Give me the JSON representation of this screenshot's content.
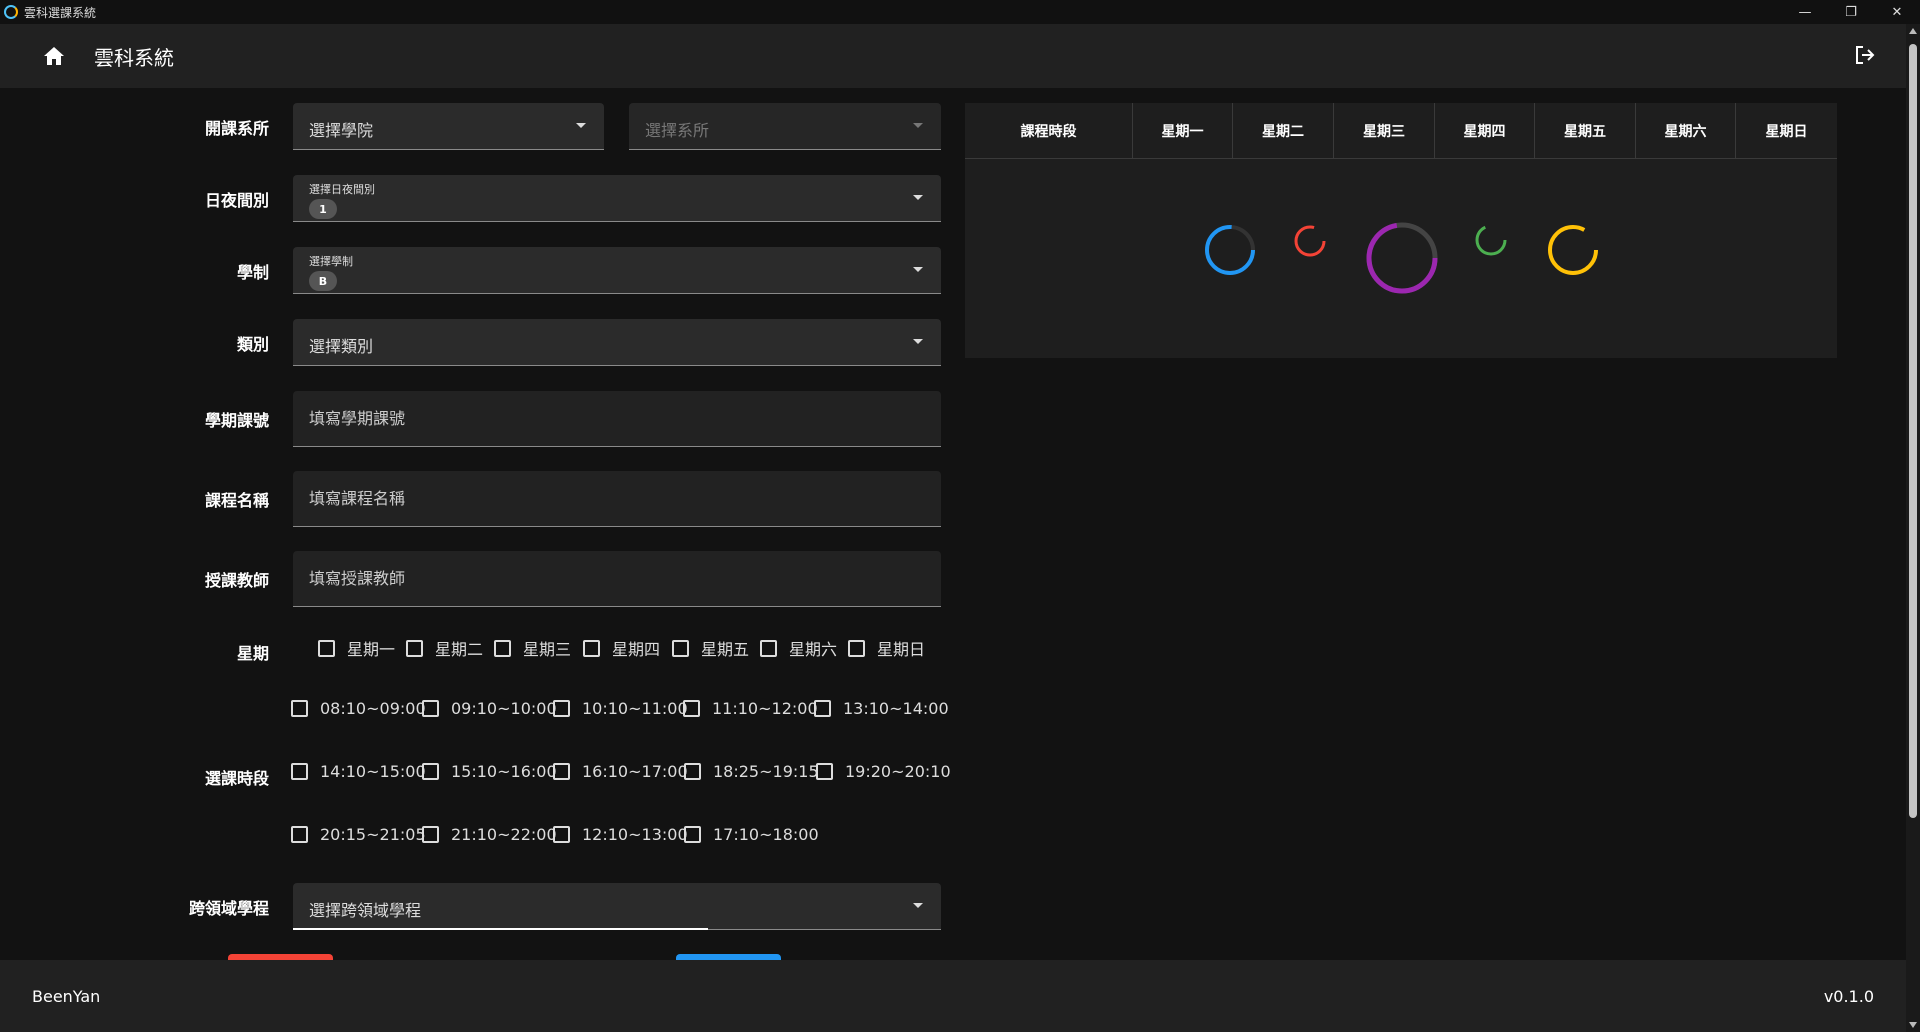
{
  "window": {
    "title": "雲科選課系統",
    "controls": [
      "minimize-icon",
      "restore-icon",
      "close-icon"
    ]
  },
  "appbar": {
    "title": "雲科系統",
    "home_icon": "home-icon",
    "logout_icon": "logout-icon"
  },
  "form": {
    "dept": {
      "label": "開課系所",
      "college_placeholder": "選擇學院",
      "dept_placeholder": "選擇系所"
    },
    "daynight": {
      "label": "日夜間別",
      "field_label": "選擇日夜間別",
      "chip": "1"
    },
    "system": {
      "label": "學制",
      "field_label": "選擇學制",
      "chip": "B"
    },
    "category": {
      "label": "類別",
      "placeholder": "選擇類別"
    },
    "course_no": {
      "label": "學期課號",
      "placeholder": "填寫學期課號"
    },
    "course_name": {
      "label": "課程名稱",
      "placeholder": "填寫課程名稱"
    },
    "teacher": {
      "label": "授課教師",
      "placeholder": "填寫授課教師"
    },
    "weekday": {
      "label": "星期",
      "options": [
        "星期一",
        "星期二",
        "星期三",
        "星期四",
        "星期五",
        "星期六",
        "星期日"
      ]
    },
    "timeslot": {
      "label": "選課時段",
      "rows": [
        [
          "08:10~09:00",
          "09:10~10:00",
          "10:10~11:00",
          "11:10~12:00",
          "13:10~14:00"
        ],
        [
          "14:10~15:00",
          "15:10~16:00",
          "16:10~17:00",
          "18:25~19:15",
          "19:20~20:10"
        ],
        [
          "20:15~21:05",
          "21:10~22:00",
          "12:10~13:00",
          "17:10~18:00"
        ]
      ]
    },
    "cross": {
      "label": "跨領域學程",
      "placeholder": "選擇跨領域學程"
    }
  },
  "schedule": {
    "columns": [
      "課程時段",
      "星期一",
      "星期二",
      "星期三",
      "星期四",
      "星期五",
      "星期六",
      "星期日"
    ],
    "spinner_colors": [
      "#2196f3",
      "#f44336",
      "#9c27b0",
      "#4caf50",
      "#ffc107"
    ]
  },
  "footer": {
    "author": "BeenYan",
    "version": "v0.1.0"
  },
  "colors": {
    "accent_red": "#f44336",
    "accent_blue": "#2196f3"
  }
}
